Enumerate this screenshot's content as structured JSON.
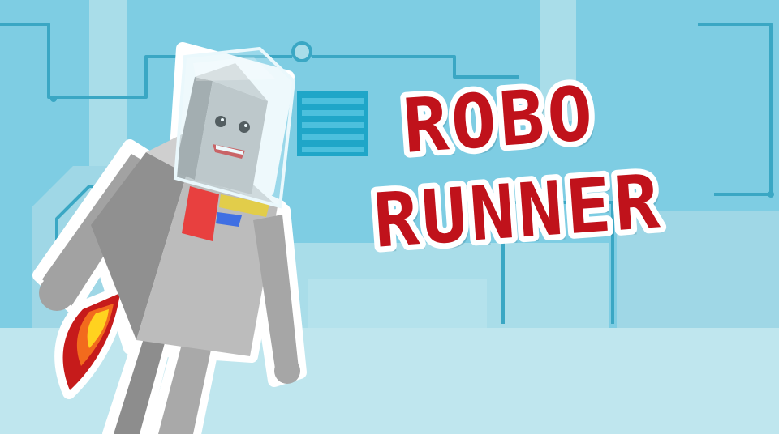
{
  "game": {
    "title_line1": "ROBO",
    "title_line2": "RUNNER"
  },
  "colors": {
    "sky": "#7ecde3",
    "floor": "#bfe6ee",
    "circuit": "#3aa7c4",
    "title_red": "#c0121b",
    "robot_body": "#b9b9b9",
    "flame_outer": "#c61b1b",
    "flame_mid": "#f26b1d",
    "flame_inner": "#ffd21f"
  },
  "icons": [
    "robot-character",
    "jetpack-flame-icon",
    "vent-panel-icon",
    "circuit-node-icon"
  ]
}
